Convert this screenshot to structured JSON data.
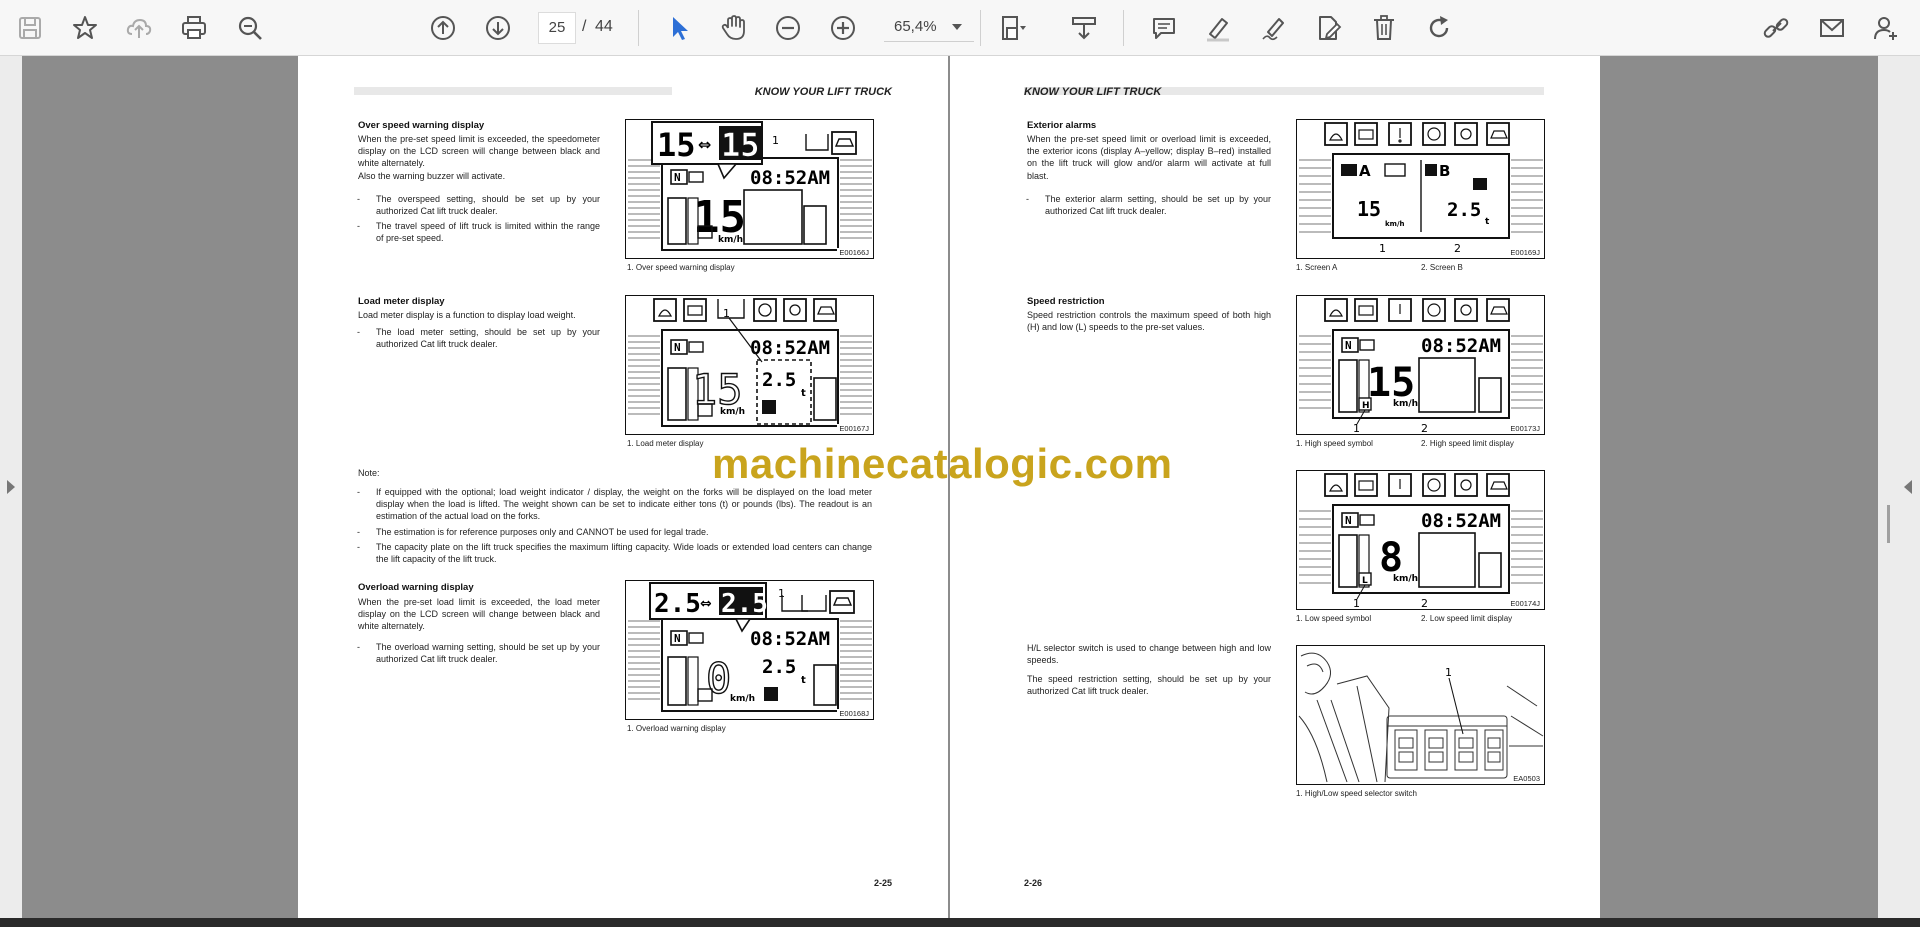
{
  "toolbar": {
    "current_page": "25",
    "page_separator": "/",
    "total_pages": "44",
    "zoom_value": "65,4%"
  },
  "left_page": {
    "header": "KNOW YOUR LIFT TRUCK",
    "page_number": "2-25",
    "sections": {
      "overspeed": {
        "title": "Over speed warning display",
        "paragraphs": [
          "When the pre-set speed limit is exceeded, the speedometer display on the LCD screen will change between black and white alternately.",
          "Also the warning buzzer will activate."
        ],
        "bullets": [
          "The overspeed setting, should be set up by your authorized Cat lift truck dealer.",
          "The travel speed of lift truck is limited within the range of pre-set speed."
        ],
        "figure_code": "E00166J",
        "caption": "1. Over speed warning display",
        "figure_texts": {
          "num_a": "15",
          "num_b": "15",
          "label_1": "1",
          "clock": "08:52AM",
          "speed": "15",
          "unit": "km/h",
          "neutral": "N"
        }
      },
      "loadmeter": {
        "title": "Load meter display",
        "paragraphs": [
          "Load meter display is a function to display load weight."
        ],
        "bullets": [
          "The load meter setting, should be set up by your authorized Cat lift truck dealer."
        ],
        "figure_code": "E00167J",
        "caption": "1. Load meter display",
        "figure_texts": {
          "label_1": "1",
          "clock": "08:52AM",
          "speed": "15",
          "unit": "km/h",
          "load": "2.5",
          "ton": "t",
          "neutral": "N"
        }
      },
      "note": {
        "title": "Note:",
        "bullets": [
          "If equipped with the optional; load weight indicator / display, the weight on the forks will be displayed on the load meter display when the load is lifted. The weight shown can be set to indicate either tons (t) or pounds (lbs). The readout is an estimation of the actual load on the forks.",
          "The estimation is for reference purposes only and CANNOT be used for legal trade.",
          "The capacity plate on the lift truck specifies the maximum lifting capacity. Wide loads or extended load centers can change the lift capacity of the lift truck."
        ]
      },
      "overload": {
        "title": "Overload warning display",
        "paragraphs": [
          "When the pre-set load limit is exceeded, the load meter display on the LCD screen will change between black and white alternately."
        ],
        "bullets": [
          "The overload warning setting, should be set up by your authorized Cat lift truck dealer."
        ],
        "figure_code": "E00168J",
        "caption": "1. Overload warning display",
        "figure_texts": {
          "num_a": "2.5",
          "num_b": "2.5",
          "label_1": "1",
          "clock": "08:52AM",
          "speed": "0",
          "unit": "km/h",
          "load": "2.5",
          "ton": "t",
          "neutral": "N"
        }
      }
    }
  },
  "right_page": {
    "header": "KNOW YOUR LIFT TRUCK",
    "page_number": "2-26",
    "sections": {
      "exterior": {
        "title": "Exterior alarms",
        "paragraphs": [
          "When the pre-set speed limit or overload limit is exceeded, the exterior icons (display A–yellow; display B–red) installed on the lift truck will glow and/or alarm will activate at full blast."
        ],
        "bullets": [
          "The exterior alarm setting, should be set up by your authorized Cat lift truck dealer."
        ],
        "figure_code": "E00169J",
        "caption_1": "1. Screen A",
        "caption_2": "2. Screen B",
        "figure_texts": {
          "label_a": "A",
          "label_b": "B",
          "speed": "15",
          "unit": "km/h",
          "load": "2.5",
          "ton": "t",
          "n1": "1",
          "n2": "2"
        }
      },
      "speedres": {
        "title": "Speed restriction",
        "paragraphs": [
          "Speed restriction controls the maximum speed of both high (H) and low (L) speeds to the pre-set values."
        ],
        "figure_code": "E00173J",
        "caption_1": "1. High speed symbol",
        "caption_2": "2. High speed limit display",
        "figure_texts": {
          "clock": "08:52AM",
          "speed": "15",
          "unit": "km/h",
          "hl": "H",
          "n1": "1",
          "n2": "2",
          "neutral": "N"
        }
      },
      "lowspeed": {
        "figure_code": "E00174J",
        "caption_1": "1. Low speed symbol",
        "caption_2": "2. Low speed limit display",
        "figure_texts": {
          "clock": "08:52AM",
          "speed": "8",
          "unit": "km/h",
          "hl": "L",
          "n1": "1",
          "n2": "2",
          "neutral": "N"
        }
      },
      "selector": {
        "paragraphs": [
          "H/L selector switch is used to change between high and low speeds.",
          "The speed restriction setting, should be set up by your authorized Cat lift truck dealer."
        ],
        "figure_code": "EA0503",
        "caption": "1. High/Low speed selector switch",
        "figure_texts": {
          "n1": "1"
        }
      }
    }
  },
  "watermark": "machinecatalogic.com",
  "icons": {
    "left_group": [
      "save-icon",
      "bookmark-star-icon",
      "cloud-upload-icon",
      "print-icon",
      "zoom-out-search-icon"
    ],
    "nav_group": [
      "page-up-icon",
      "page-down-icon"
    ],
    "tools_group": [
      "select-cursor-icon",
      "hand-icon",
      "zoom-minus-icon",
      "zoom-plus-icon"
    ],
    "mid_group": [
      "page-fit-icon",
      "download-tray-icon"
    ],
    "annot_group": [
      "comment-icon",
      "highlight-pen-icon",
      "sign-pen-icon",
      "edit-document-icon",
      "delete-trash-icon",
      "rotate-icon"
    ],
    "right_group": [
      "attach-link-icon",
      "mail-icon",
      "add-user-icon"
    ]
  },
  "colors": {
    "accent": "#2d6fd6",
    "watermark": "#c9a41d",
    "icon": "#555555"
  }
}
